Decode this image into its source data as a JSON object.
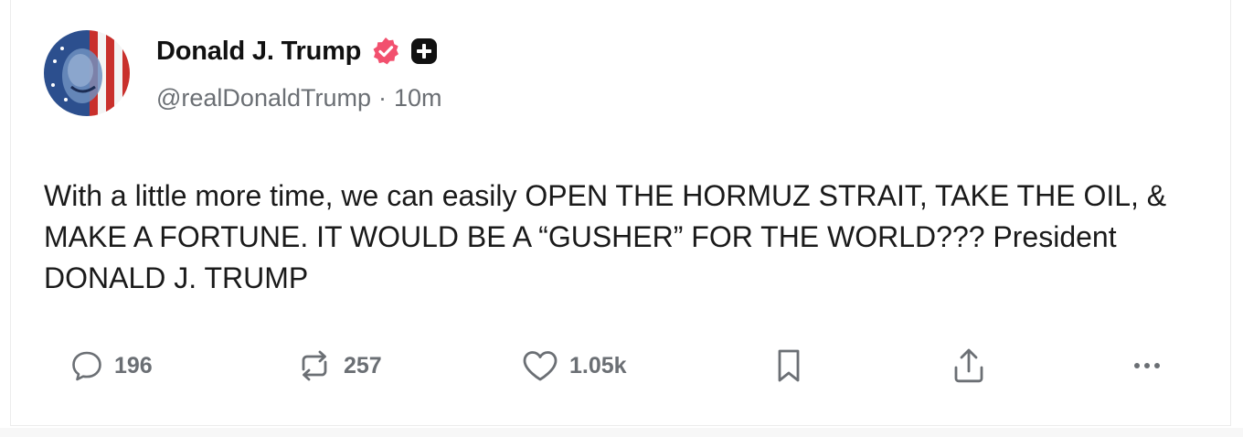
{
  "author": {
    "display_name": "Donald J. Trump",
    "handle": "@realDonaldTrump",
    "separator": "·",
    "timestamp": "10m",
    "verified_badge_color": "#f2506e",
    "plus_badge_color": "#111111"
  },
  "post": {
    "text": "With a little more time, we can easily OPEN THE HORMUZ STRAIT, TAKE THE OIL, & MAKE A FORTUNE. IT WOULD BE A “GUSHER” FOR THE WORLD??? President DONALD J. TRUMP"
  },
  "actions": {
    "replies": "196",
    "reposts": "257",
    "likes": "1.05k"
  },
  "icons": {
    "reply": "reply-icon",
    "repost": "repost-icon",
    "like": "heart-icon",
    "bookmark": "bookmark-icon",
    "share": "share-icon",
    "more": "more-icon"
  }
}
